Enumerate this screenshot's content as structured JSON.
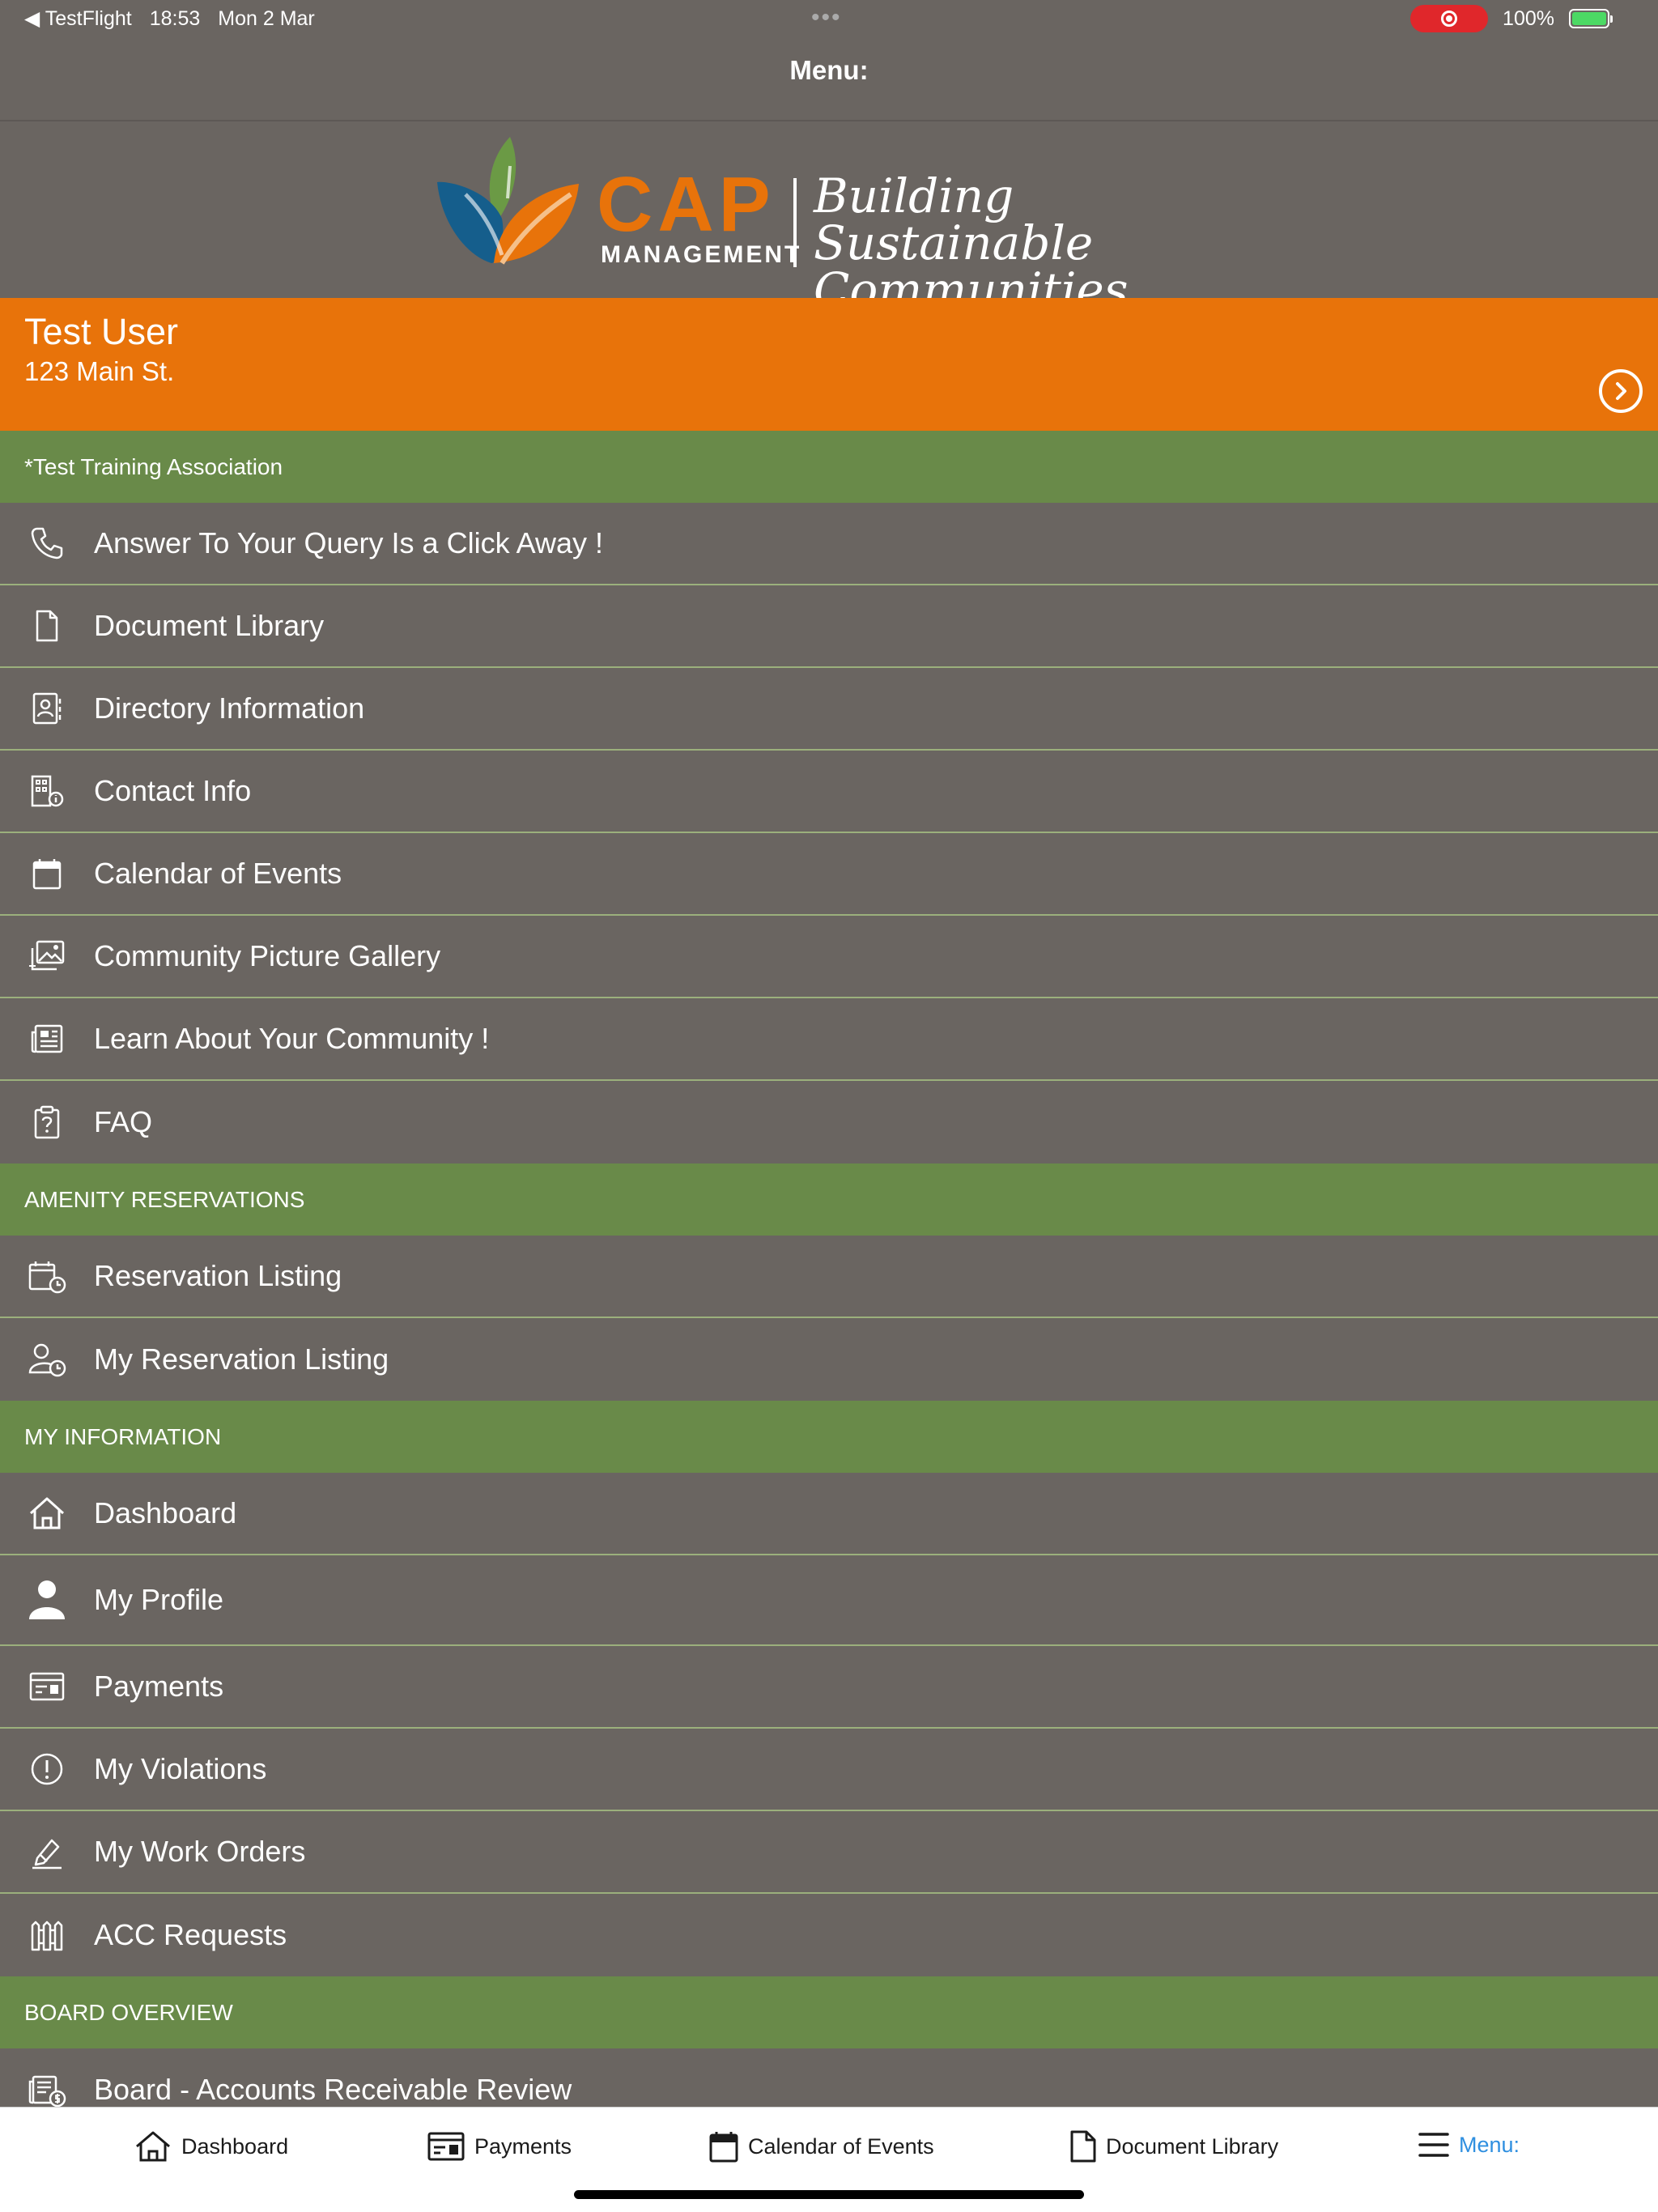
{
  "status_bar": {
    "back_app": "◀ TestFlight",
    "time": "18:53",
    "date": "Mon 2 Mar",
    "dots": "•••",
    "battery": "100%"
  },
  "nav": {
    "title": "Menu:"
  },
  "logo": {
    "brand": "CAP",
    "brand_sub": "MANAGEMENT",
    "tagline_line1": "Building Sustainable",
    "tagline_line2": "Communities"
  },
  "user": {
    "name": "Test User",
    "address": "123 Main St."
  },
  "sections": {
    "association": "*Test Training Association",
    "amenity": "AMENITY RESERVATIONS",
    "my_info": "MY INFORMATION",
    "board": "BOARD OVERVIEW"
  },
  "menu_items": {
    "query": "Answer To Your Query Is a Click Away !",
    "document_library": "Document Library",
    "directory": "Directory Information",
    "contact": "Contact Info",
    "calendar": "Calendar of Events",
    "gallery": "Community Picture Gallery",
    "learn": "Learn About Your Community !",
    "faq": "FAQ",
    "reservation_listing": "Reservation Listing",
    "my_reservation_listing": "My Reservation Listing",
    "dashboard": "Dashboard",
    "my_profile": "My Profile",
    "payments": "Payments",
    "my_violations": "My Violations",
    "my_work_orders": "My Work Orders",
    "acc_requests": "ACC Requests",
    "board_ar_review": "Board - Accounts Receivable Review"
  },
  "tabbar": {
    "dashboard": "Dashboard",
    "payments": "Payments",
    "calendar": "Calendar of Events",
    "document_library": "Document Library",
    "menu": "Menu:"
  },
  "colors": {
    "background": "#6a6561",
    "accent_orange": "#e8730a",
    "section_green": "#698a49",
    "active_tab": "#2f8fe0"
  }
}
